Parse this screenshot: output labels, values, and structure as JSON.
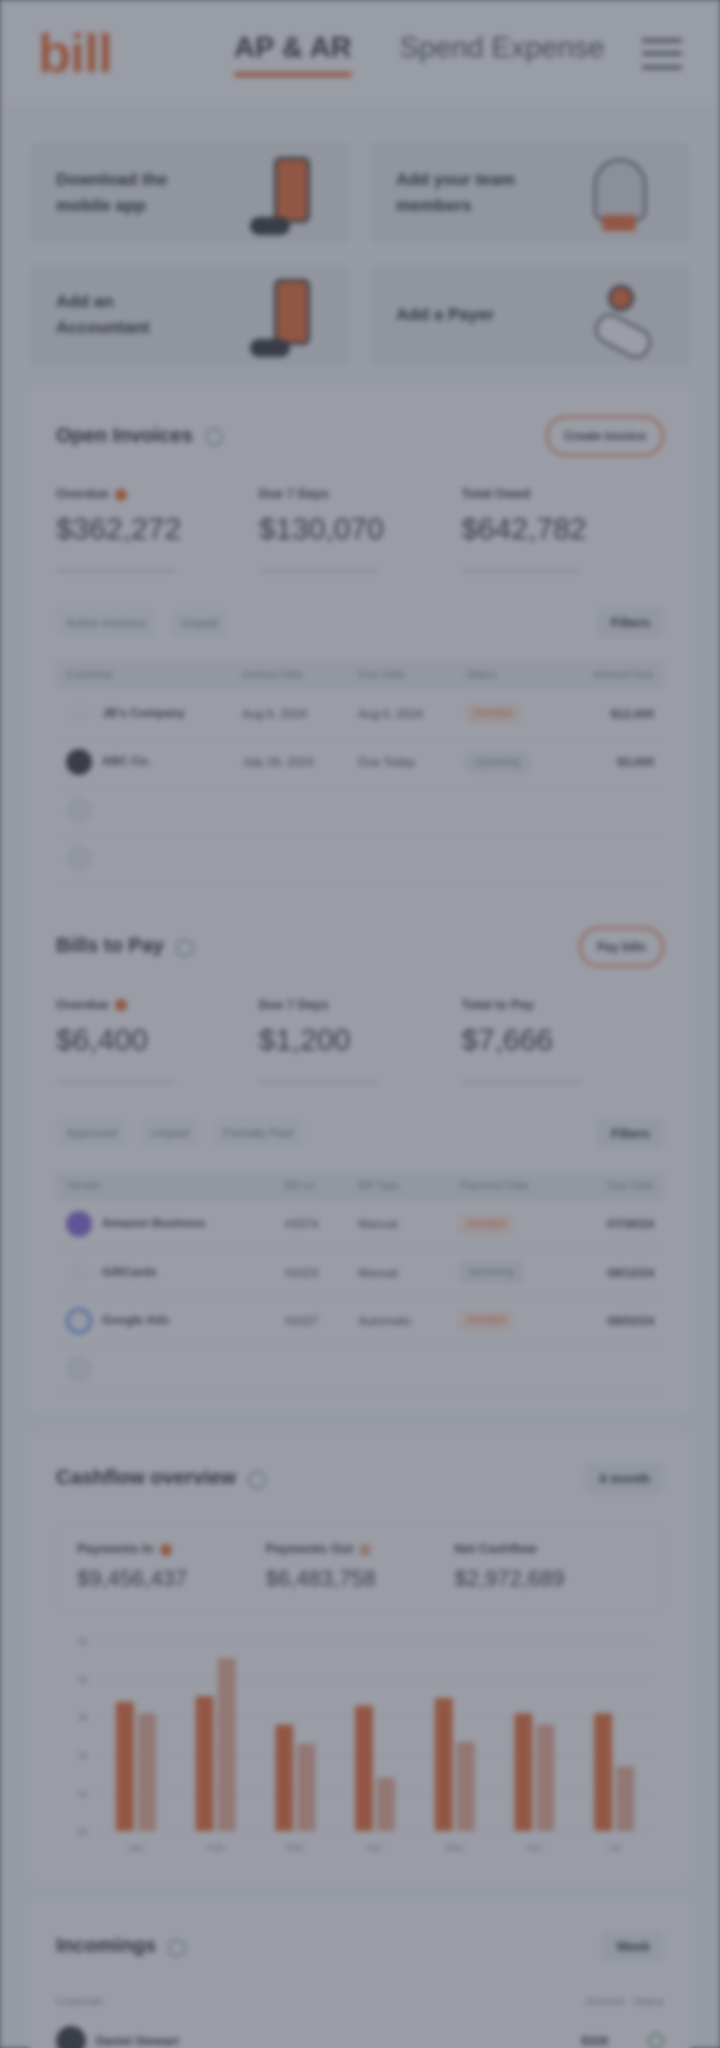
{
  "header": {
    "logo": "bill",
    "tabs": [
      {
        "label": "AP & AR",
        "active": true
      },
      {
        "label": "Spend Expense",
        "active": false
      }
    ]
  },
  "promos": [
    {
      "label": "Download the mobile app"
    },
    {
      "label": "Add your team members"
    },
    {
      "label": "Add an Accountant"
    },
    {
      "label": "Add a Payer"
    }
  ],
  "open_invoices": {
    "title": "Open Invoices",
    "action": "Create invoice",
    "stats": [
      {
        "label": "Overdue",
        "value": "$362,272",
        "alert": true
      },
      {
        "label": "Due 7 Days",
        "value": "$130,070",
        "alert": false
      },
      {
        "label": "Total Owed",
        "value": "$642,782",
        "alert": false
      }
    ],
    "filters": [
      "Active Invoices",
      "Unpaid"
    ],
    "filters_button": "Filters",
    "columns": [
      "Customer",
      "Invoice Date",
      "Due Date",
      "Status",
      "Amount Due"
    ],
    "rows": [
      {
        "customer": "JB's Company",
        "invoice_date": "Aug 6, 2024",
        "due_date": "Aug 6, 2024",
        "status": "Overdue",
        "amount": "$12,000"
      },
      {
        "customer": "ABC Co.",
        "invoice_date": "July 29, 2024",
        "due_date": "Due Today",
        "status": "Upcoming",
        "amount": "$3,000"
      }
    ]
  },
  "bills": {
    "title": "Bills to Pay",
    "action": "Pay bills",
    "stats": [
      {
        "label": "Overdue",
        "value": "$6,400",
        "alert": true
      },
      {
        "label": "Due 7 Days",
        "value": "$1,200",
        "alert": false
      },
      {
        "label": "Total to Pay",
        "value": "$7,666",
        "alert": false
      }
    ],
    "filters": [
      "Approved",
      "Unpaid",
      "Partially Paid"
    ],
    "filters_button": "Filters",
    "columns": [
      "Vendor",
      "Bill no.",
      "Bill Type",
      "Payment Date",
      "Due Date"
    ],
    "rows": [
      {
        "vendor": "Amazon Business",
        "bill_no": "#3374",
        "type": "Manual",
        "status": "Overdue",
        "due": "07/30/24"
      },
      {
        "vendor": "GiftCards",
        "bill_no": "#1023",
        "type": "Manual",
        "status": "Upcoming",
        "due": "08/12/24"
      },
      {
        "vendor": "Google Ads",
        "bill_no": "#1027",
        "type": "Automatic",
        "status": "Overdue",
        "due": "08/02/24"
      }
    ]
  },
  "cashflow": {
    "title": "Cashflow overview",
    "period": "6 month",
    "summary": [
      {
        "label": "Payments In",
        "value": "$9,456,437"
      },
      {
        "label": "Payments Out",
        "value": "$6,483,758"
      },
      {
        "label": "Net Cashflow",
        "value": "$2,972,689"
      }
    ]
  },
  "chart_data": {
    "type": "bar",
    "categories": [
      "Jan",
      "Feb",
      "Mar",
      "Apr",
      "May",
      "Jun",
      "Jul"
    ],
    "ylim": [
      0,
      5000
    ],
    "yticks": [
      "0k",
      "1k",
      "2k",
      "3k",
      "4k",
      "5k"
    ],
    "series": [
      {
        "name": "Payments In",
        "values": [
          3400,
          3550,
          2800,
          3300,
          3500,
          3100,
          3100
        ]
      },
      {
        "name": "Payments Out",
        "values": [
          3100,
          4550,
          2300,
          1400,
          2350,
          2800,
          1700
        ]
      }
    ],
    "colors": {
      "in": "#e4632d",
      "out": "#e3a58f"
    }
  },
  "incomings": {
    "title": "Incomings",
    "period": "Week",
    "columns": [
      "Customer",
      "Amount",
      "Status"
    ],
    "rows": [
      {
        "customer": "Daniel Stewart",
        "amount": "$328"
      }
    ]
  },
  "colors": {
    "accent": "#e4632d",
    "overlay": "#464c5a"
  }
}
